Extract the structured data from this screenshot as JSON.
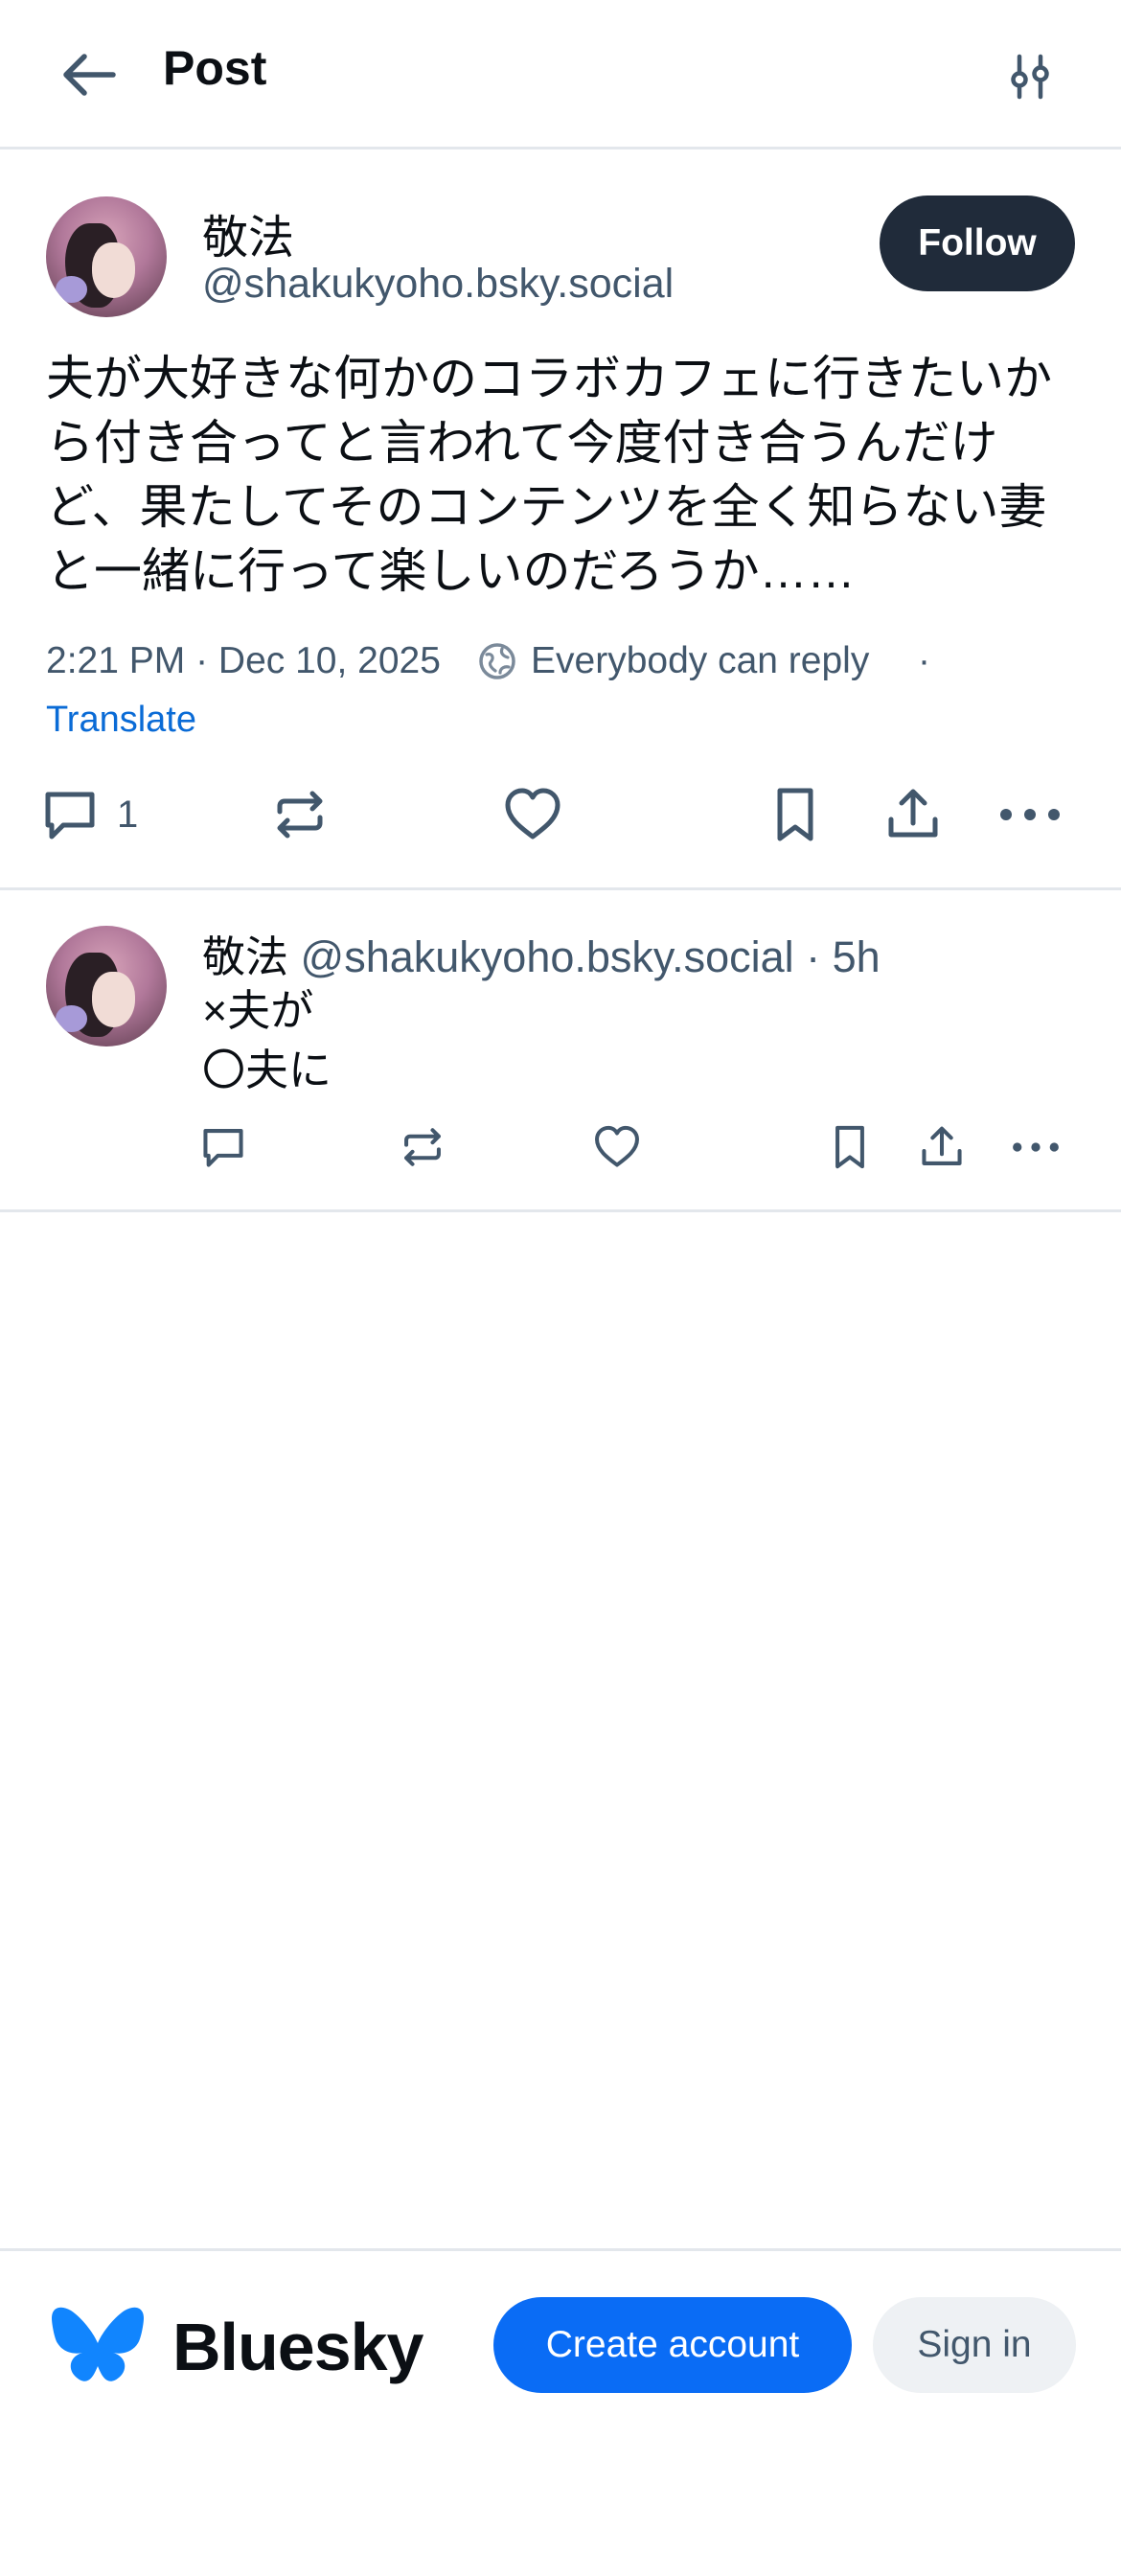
{
  "header": {
    "title": "Post"
  },
  "post": {
    "author_name": "敬法",
    "author_handle": "@shakukyoho.bsky.social",
    "follow_label": "Follow",
    "text": "夫が大好きな何かのコラボカフェに行きたいから付き合ってと言われて今度付き合うんだけど、果たしてそのコンテンツを全く知らない妻と一緒に行って楽しいのだろうか……",
    "timestamp": "2:21 PM · Dec 10, 2025",
    "reply_setting": "Everybody can reply",
    "meta_separator": "·",
    "translate_label": "Translate",
    "reply_count": "1",
    "icons": [
      "reply-icon",
      "repost-icon",
      "like-icon",
      "bookmark-icon",
      "share-icon",
      "more-icon"
    ]
  },
  "reply": {
    "author_name": "敬法",
    "author_handle": "@shakukyoho.bsky.social",
    "age": "· 5h",
    "line1": "×夫が",
    "line2": "〇夫に"
  },
  "footer": {
    "brand": "Bluesky",
    "create_label": "Create account",
    "signin_label": "Sign in"
  },
  "colors": {
    "accent": "#0a6cf5",
    "follow_bg": "#202b3a",
    "muted_text": "#42576c",
    "link": "#0a6bd6",
    "divider": "#e3e7ec"
  }
}
